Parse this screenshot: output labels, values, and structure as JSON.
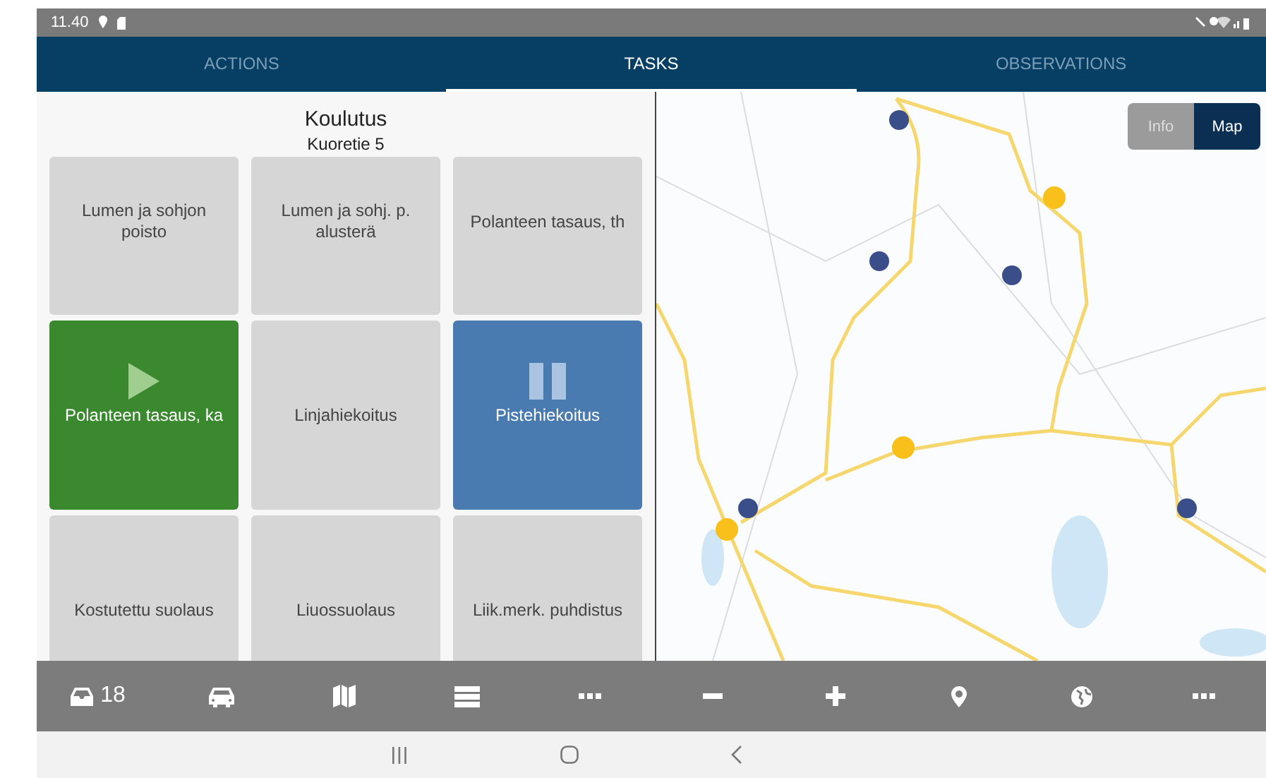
{
  "status_bar": {
    "time": "11.40"
  },
  "tabs": [
    {
      "label": "ACTIONS",
      "selected": false
    },
    {
      "label": "TASKS",
      "selected": true
    },
    {
      "label": "OBSERVATIONS",
      "selected": false
    }
  ],
  "task_panel": {
    "title": "Koulutus",
    "subtitle": "Kuoretie 5",
    "tiles": [
      {
        "label": "Lumen ja sohjon poisto",
        "kind": "idle"
      },
      {
        "label": "Lumen ja sohj. p. alusterä",
        "kind": "idle"
      },
      {
        "label": "Polanteen tasaus, th",
        "kind": "idle"
      },
      {
        "label": "Polanteen tasaus, ka",
        "kind": "running"
      },
      {
        "label": "Linjahiekoitus",
        "kind": "idle"
      },
      {
        "label": "Pistehiekoitus",
        "kind": "paused"
      },
      {
        "label": "Kostutettu suolaus",
        "kind": "idle"
      },
      {
        "label": "Liuossuolaus",
        "kind": "idle"
      },
      {
        "label": "Liik.merk. puhdistus",
        "kind": "idle"
      }
    ]
  },
  "view_toggle": [
    {
      "label": "Info",
      "selected": false
    },
    {
      "label": "Map",
      "selected": true
    }
  ],
  "toolbar": [
    {
      "kind": "inbox",
      "count": "18"
    },
    {
      "kind": "car"
    },
    {
      "kind": "map"
    },
    {
      "kind": "list"
    },
    {
      "kind": "more"
    },
    {
      "kind": "minus"
    },
    {
      "kind": "plus"
    },
    {
      "kind": "pin"
    },
    {
      "kind": "globe"
    },
    {
      "kind": "more"
    }
  ]
}
